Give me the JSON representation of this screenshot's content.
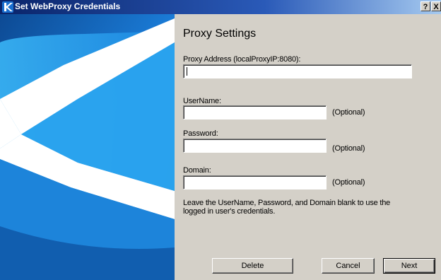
{
  "window": {
    "title": "Set WebProxy Credentials",
    "help_glyph": "?",
    "close_glyph": "X",
    "icon": "k-logo-icon"
  },
  "content": {
    "heading": "Proxy Settings",
    "fields": {
      "proxy_address": {
        "label": "Proxy Address (localProxyIP:8080):",
        "value": ""
      },
      "username": {
        "label": "UserName:",
        "value": "",
        "hint": "(Optional)"
      },
      "password": {
        "label": "Password:",
        "value": "",
        "hint": "(Optional)"
      },
      "domain": {
        "label": "Domain:",
        "value": "",
        "hint": "(Optional)"
      }
    },
    "note": "Leave the UserName, Password, and Domain blank to use the logged in user's credentials."
  },
  "buttons": {
    "delete": "Delete",
    "cancel": "Cancel",
    "next": "Next"
  },
  "colors": {
    "title_start": "#0a246a",
    "title_end": "#a6caf0",
    "panel": "#d4d0c8",
    "art_blue": "#1f8fe0",
    "art_dark": "#0b3a78"
  }
}
